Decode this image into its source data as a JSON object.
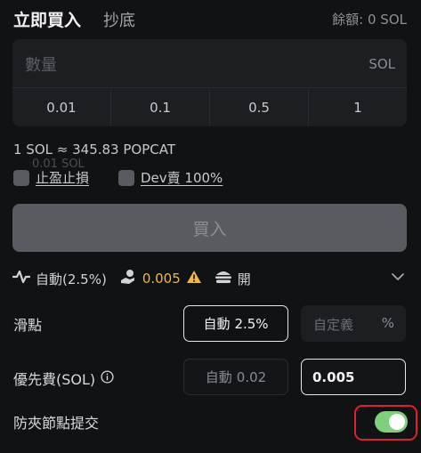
{
  "tabs": {
    "active": "立即買入",
    "other": "抄底"
  },
  "balance": "餘額: 0 SOL",
  "amount": {
    "placeholder": "數量",
    "unit": "SOL",
    "presets": [
      "0.01",
      "0.1",
      "0.5",
      "1"
    ]
  },
  "rate": "1 SOL ≈ 345.83 POPCAT",
  "ghost_amount": "0.01 SOL",
  "options": {
    "take_profit": "止盈止損",
    "dev_sell": "Dev賣 100%"
  },
  "buy_button": "買入",
  "settings": {
    "slippage_mode": "自動(2.5%)",
    "priority_fee": "0.005",
    "mev": "開"
  },
  "slippage": {
    "label": "滑點",
    "auto_label": "自動",
    "auto_value": "2.5%",
    "custom_placeholder": "自定義",
    "custom_unit": "%"
  },
  "fee": {
    "label": "優先費(SOL)",
    "auto_label": "自動",
    "auto_value": "0.02",
    "value": "0.005"
  },
  "mev": {
    "label": "防夾節點提交",
    "enabled": true
  },
  "colors": {
    "toggle_on": "#7fcf7e",
    "highlight": "#e0202a",
    "warning": "#f5b832"
  }
}
